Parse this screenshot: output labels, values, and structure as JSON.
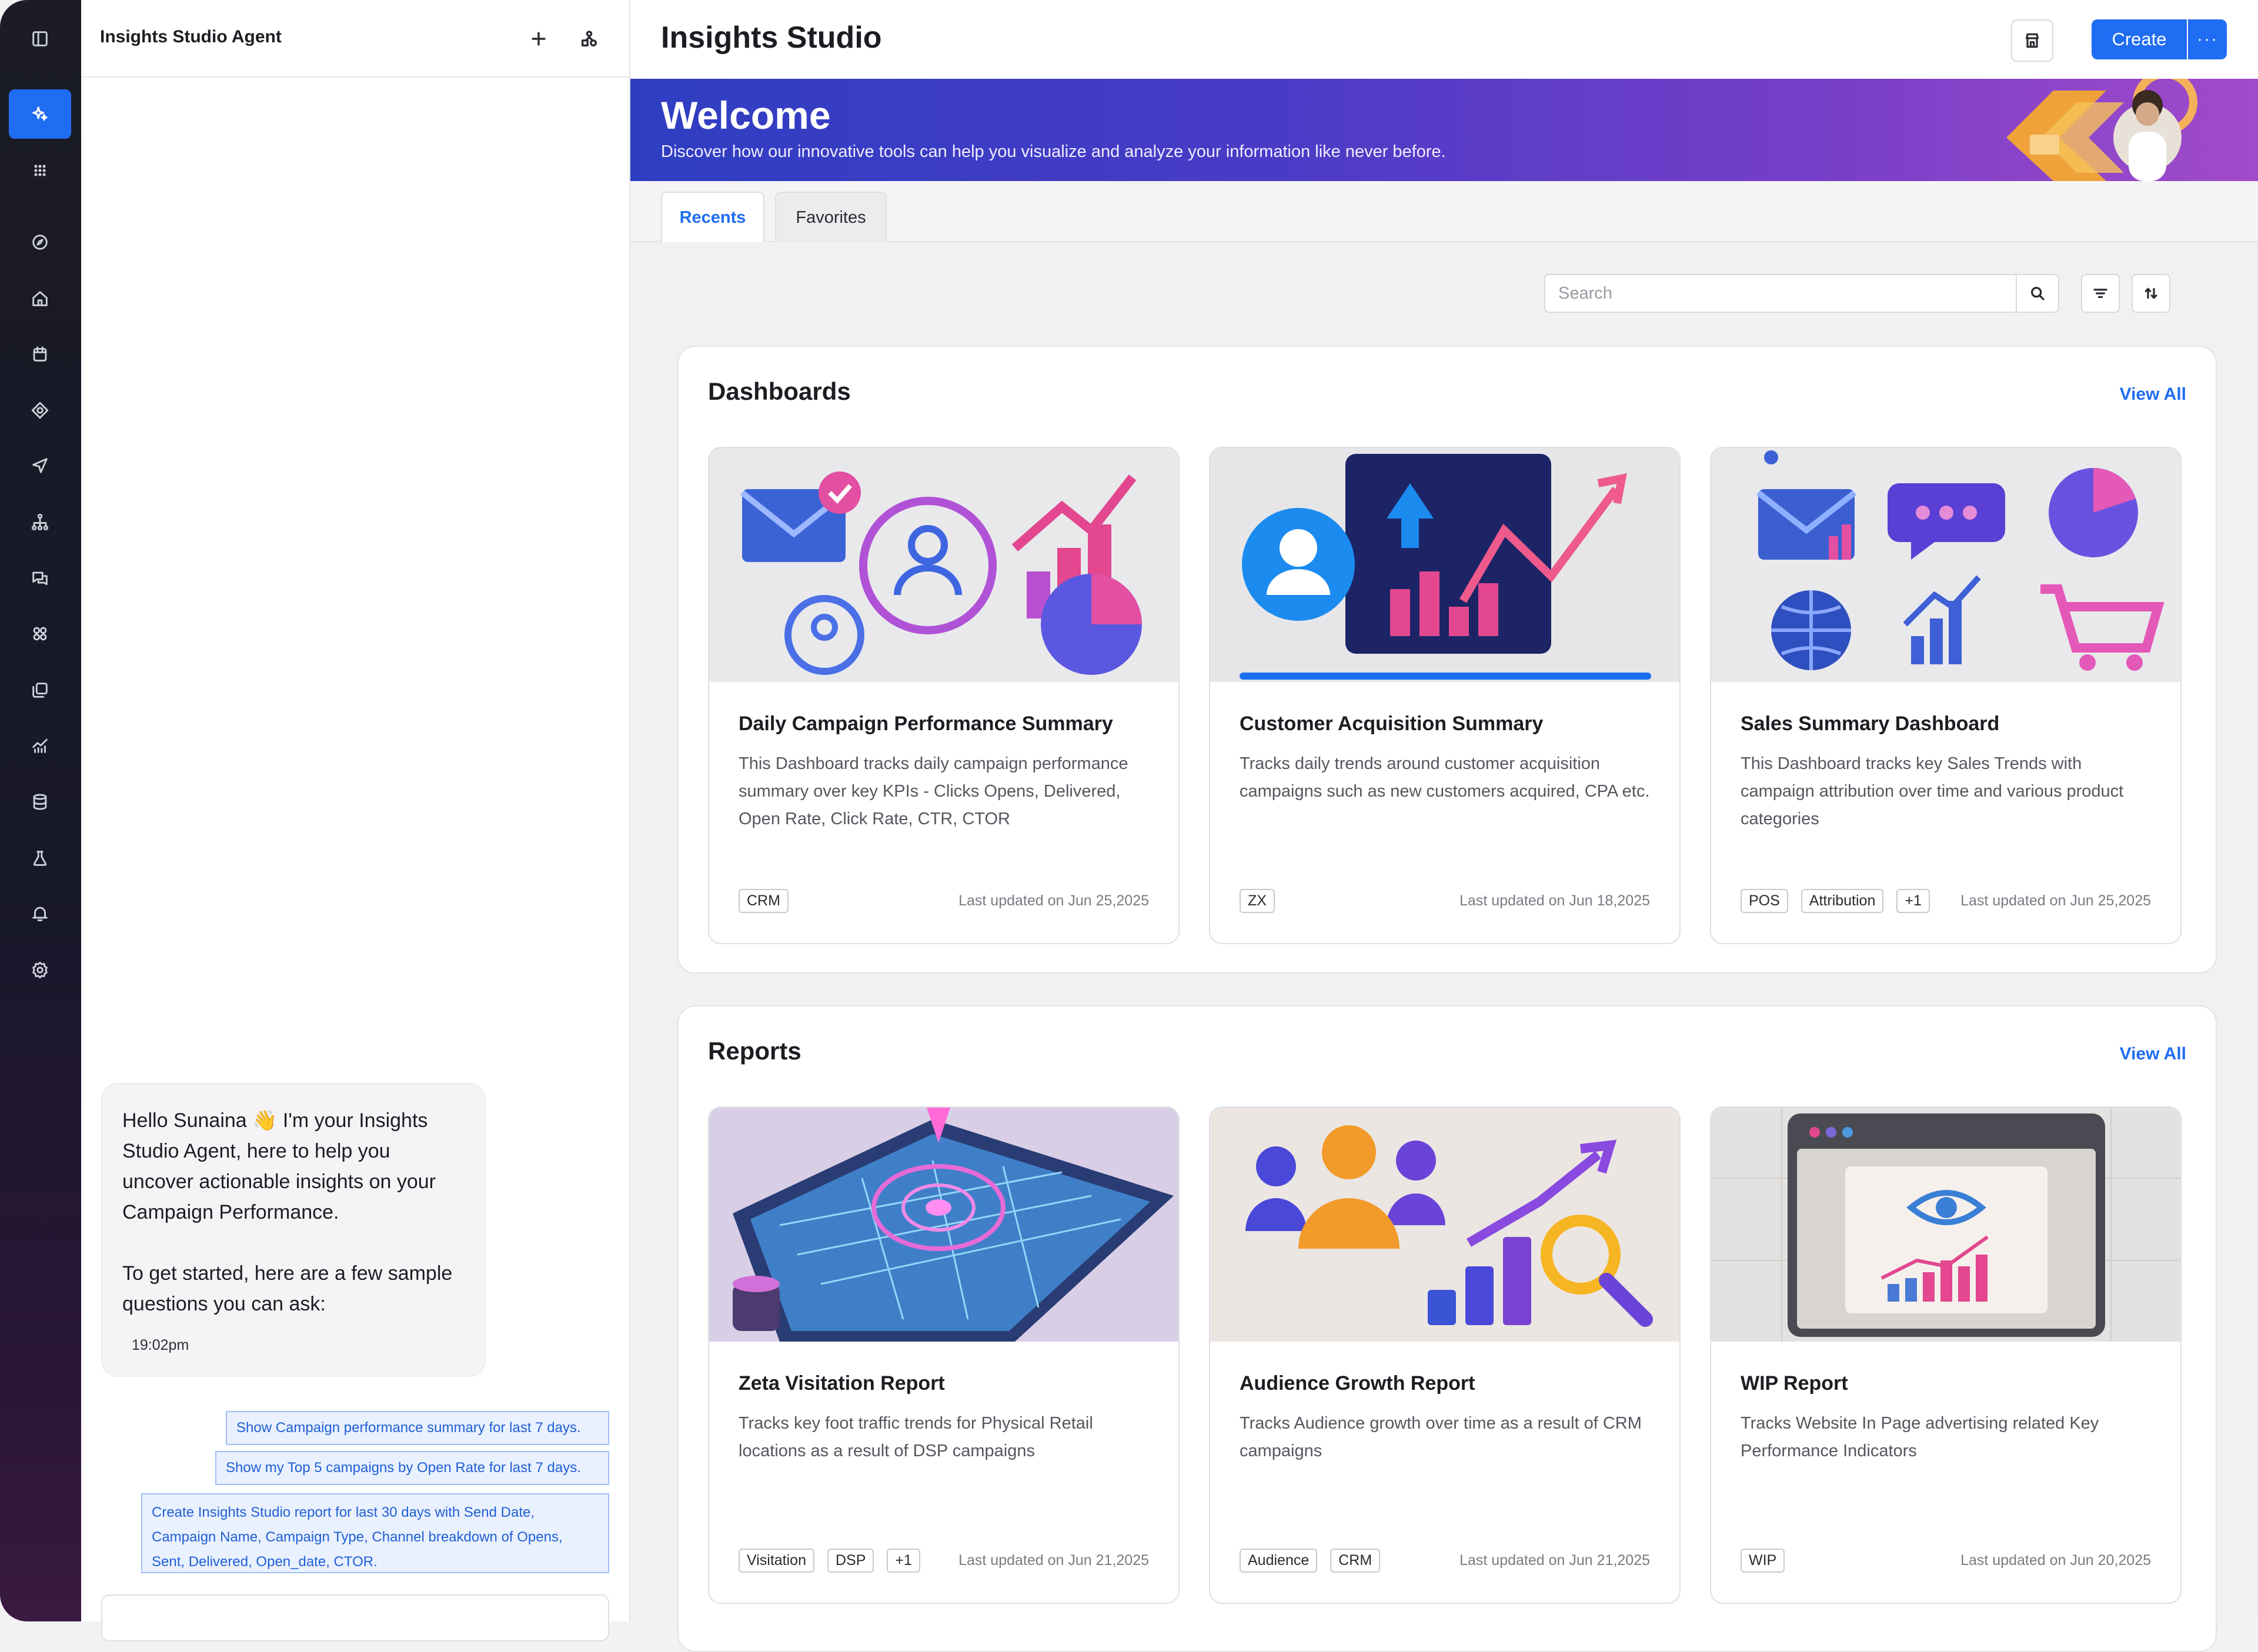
{
  "rail": {
    "icons": [
      "panel-toggle-icon",
      "sparkle-agent-icon",
      "apps-grid-icon",
      "compass-icon",
      "home-icon",
      "calendar-icon",
      "target-icon",
      "send-icon",
      "hierarchy-icon",
      "chat-icon",
      "integrations-icon",
      "layers-icon",
      "analytics-icon",
      "database-icon",
      "lab-flask-icon",
      "bell-icon",
      "settings-gear-icon"
    ],
    "active_index": 1
  },
  "agent": {
    "title": "Insights Studio Agent",
    "message": {
      "greeting": "Hello Sunaina 👋 I'm your Insights Studio Agent, here to help you uncover actionable insights on your Campaign Performance.",
      "prompt": "To get started, here are a few sample questions you can ask:",
      "time": "19:02pm"
    },
    "suggestions": [
      "Show Campaign performance summary for last 7 days.",
      "Show my Top 5 campaigns by Open Rate for last 7 days.",
      "Create Insights Studio report for last 30 days with Send Date, Campaign Name, Campaign Type, Channel breakdown of Opens, Sent, Delivered, Open_date, CTOR."
    ]
  },
  "header": {
    "title": "Insights Studio",
    "create_label": "Create",
    "more_label": "···"
  },
  "banner": {
    "title": "Welcome",
    "subtitle": "Discover how our innovative tools can help you visualize and analyze your information like never before."
  },
  "tabs": [
    {
      "label": "Recents",
      "active": true
    },
    {
      "label": "Favorites",
      "active": false
    }
  ],
  "search": {
    "placeholder": "Search"
  },
  "dashboards": {
    "title": "Dashboards",
    "view_all": "View All",
    "cards": [
      {
        "title": "Daily Campaign Performance Summary",
        "description": "This Dashboard tracks daily campaign performance summary over key KPIs - Clicks Opens, Delivered, Open Rate, Click Rate, CTR, CTOR",
        "tags": [
          "CRM"
        ],
        "updated": "Last updated on Jun 25,2025"
      },
      {
        "title": "Customer Acquisition Summary",
        "description": "Tracks daily trends around customer acquisition campaigns such as new customers acquired, CPA etc.",
        "tags": [
          "ZX"
        ],
        "updated": "Last updated on Jun 18,2025"
      },
      {
        "title": "Sales Summary Dashboard",
        "description": "This Dashboard tracks  key Sales Trends with campaign attribution over time and various product categories",
        "tags": [
          "POS",
          "Attribution",
          "+1"
        ],
        "updated": "Last updated on Jun 25,2025"
      }
    ]
  },
  "reports": {
    "title": "Reports",
    "view_all": "View All",
    "cards": [
      {
        "title": "Zeta Visitation Report",
        "description": "Tracks key foot traffic trends for Physical Retail locations as a result of DSP campaigns",
        "tags": [
          "Visitation",
          "DSP",
          "+1"
        ],
        "updated": "Last updated on Jun 21,2025"
      },
      {
        "title": "Audience Growth Report",
        "description": "Tracks Audience growth over time as a result of CRM campaigns",
        "tags": [
          "Audience",
          "CRM"
        ],
        "updated": "Last updated on Jun 21,2025"
      },
      {
        "title": "WIP Report",
        "description": "Tracks Website In Page advertising related   Key Performance Indicators",
        "tags": [
          "WIP"
        ],
        "updated": "Last updated on Jun 20,2025"
      }
    ]
  },
  "colors": {
    "accent": "#1f6df2",
    "banner_start": "#2e3ec2",
    "banner_end": "#a14bc9"
  }
}
